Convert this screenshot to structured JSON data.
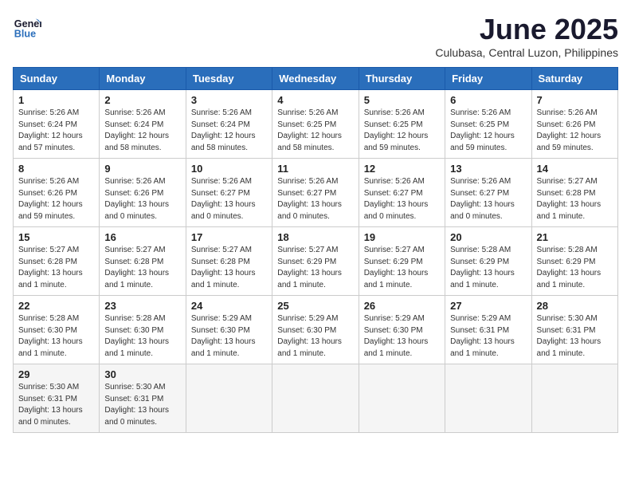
{
  "logo": {
    "line1": "General",
    "line2": "Blue"
  },
  "title": "June 2025",
  "location": "Culubasa, Central Luzon, Philippines",
  "days_of_week": [
    "Sunday",
    "Monday",
    "Tuesday",
    "Wednesday",
    "Thursday",
    "Friday",
    "Saturday"
  ],
  "weeks": [
    [
      {
        "day": "1",
        "sunrise": "5:26 AM",
        "sunset": "6:24 PM",
        "daylight": "12 hours and 57 minutes."
      },
      {
        "day": "2",
        "sunrise": "5:26 AM",
        "sunset": "6:24 PM",
        "daylight": "12 hours and 58 minutes."
      },
      {
        "day": "3",
        "sunrise": "5:26 AM",
        "sunset": "6:24 PM",
        "daylight": "12 hours and 58 minutes."
      },
      {
        "day": "4",
        "sunrise": "5:26 AM",
        "sunset": "6:25 PM",
        "daylight": "12 hours and 58 minutes."
      },
      {
        "day": "5",
        "sunrise": "5:26 AM",
        "sunset": "6:25 PM",
        "daylight": "12 hours and 59 minutes."
      },
      {
        "day": "6",
        "sunrise": "5:26 AM",
        "sunset": "6:25 PM",
        "daylight": "12 hours and 59 minutes."
      },
      {
        "day": "7",
        "sunrise": "5:26 AM",
        "sunset": "6:26 PM",
        "daylight": "12 hours and 59 minutes."
      }
    ],
    [
      {
        "day": "8",
        "sunrise": "5:26 AM",
        "sunset": "6:26 PM",
        "daylight": "12 hours and 59 minutes."
      },
      {
        "day": "9",
        "sunrise": "5:26 AM",
        "sunset": "6:26 PM",
        "daylight": "13 hours and 0 minutes."
      },
      {
        "day": "10",
        "sunrise": "5:26 AM",
        "sunset": "6:27 PM",
        "daylight": "13 hours and 0 minutes."
      },
      {
        "day": "11",
        "sunrise": "5:26 AM",
        "sunset": "6:27 PM",
        "daylight": "13 hours and 0 minutes."
      },
      {
        "day": "12",
        "sunrise": "5:26 AM",
        "sunset": "6:27 PM",
        "daylight": "13 hours and 0 minutes."
      },
      {
        "day": "13",
        "sunrise": "5:26 AM",
        "sunset": "6:27 PM",
        "daylight": "13 hours and 0 minutes."
      },
      {
        "day": "14",
        "sunrise": "5:27 AM",
        "sunset": "6:28 PM",
        "daylight": "13 hours and 1 minute."
      }
    ],
    [
      {
        "day": "15",
        "sunrise": "5:27 AM",
        "sunset": "6:28 PM",
        "daylight": "13 hours and 1 minute."
      },
      {
        "day": "16",
        "sunrise": "5:27 AM",
        "sunset": "6:28 PM",
        "daylight": "13 hours and 1 minute."
      },
      {
        "day": "17",
        "sunrise": "5:27 AM",
        "sunset": "6:28 PM",
        "daylight": "13 hours and 1 minute."
      },
      {
        "day": "18",
        "sunrise": "5:27 AM",
        "sunset": "6:29 PM",
        "daylight": "13 hours and 1 minute."
      },
      {
        "day": "19",
        "sunrise": "5:27 AM",
        "sunset": "6:29 PM",
        "daylight": "13 hours and 1 minute."
      },
      {
        "day": "20",
        "sunrise": "5:28 AM",
        "sunset": "6:29 PM",
        "daylight": "13 hours and 1 minute."
      },
      {
        "day": "21",
        "sunrise": "5:28 AM",
        "sunset": "6:29 PM",
        "daylight": "13 hours and 1 minute."
      }
    ],
    [
      {
        "day": "22",
        "sunrise": "5:28 AM",
        "sunset": "6:30 PM",
        "daylight": "13 hours and 1 minute."
      },
      {
        "day": "23",
        "sunrise": "5:28 AM",
        "sunset": "6:30 PM",
        "daylight": "13 hours and 1 minute."
      },
      {
        "day": "24",
        "sunrise": "5:29 AM",
        "sunset": "6:30 PM",
        "daylight": "13 hours and 1 minute."
      },
      {
        "day": "25",
        "sunrise": "5:29 AM",
        "sunset": "6:30 PM",
        "daylight": "13 hours and 1 minute."
      },
      {
        "day": "26",
        "sunrise": "5:29 AM",
        "sunset": "6:30 PM",
        "daylight": "13 hours and 1 minute."
      },
      {
        "day": "27",
        "sunrise": "5:29 AM",
        "sunset": "6:31 PM",
        "daylight": "13 hours and 1 minute."
      },
      {
        "day": "28",
        "sunrise": "5:30 AM",
        "sunset": "6:31 PM",
        "daylight": "13 hours and 1 minute."
      }
    ],
    [
      {
        "day": "29",
        "sunrise": "5:30 AM",
        "sunset": "6:31 PM",
        "daylight": "13 hours and 0 minutes."
      },
      {
        "day": "30",
        "sunrise": "5:30 AM",
        "sunset": "6:31 PM",
        "daylight": "13 hours and 0 minutes."
      },
      null,
      null,
      null,
      null,
      null
    ]
  ]
}
